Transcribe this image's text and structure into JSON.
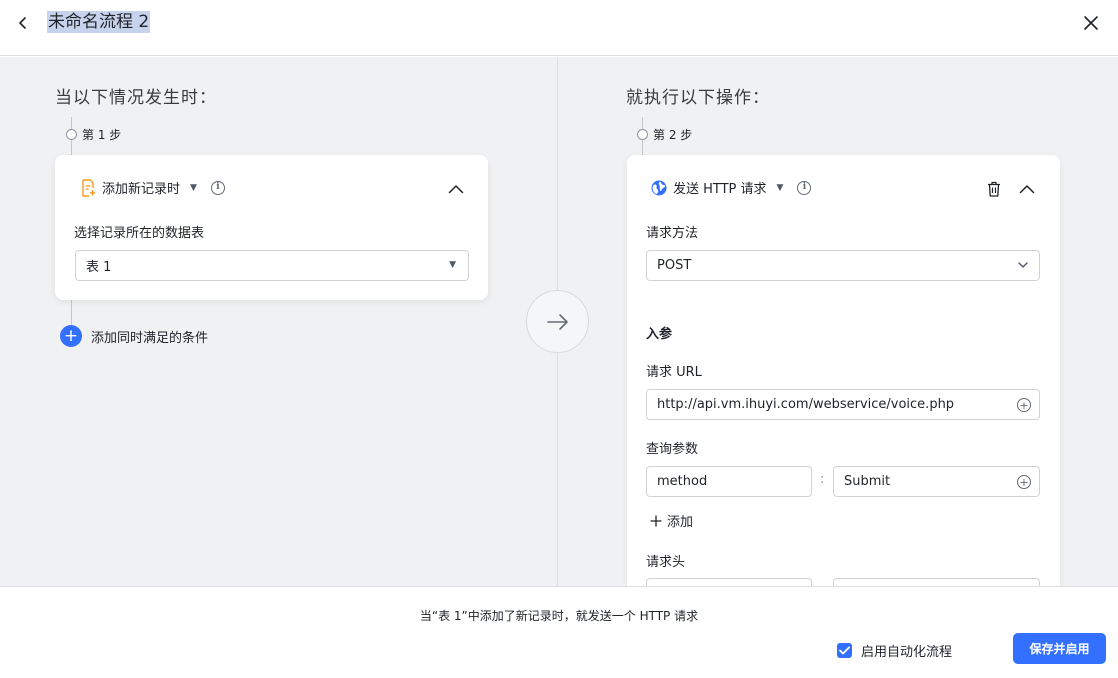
{
  "header": {
    "title": "未命名流程 2"
  },
  "trigger": {
    "heading": "当以下情况发生时：",
    "step_label": "第 1 步",
    "card_title": "添加新记录时",
    "table_label": "选择记录所在的数据表",
    "table_value": "表 1",
    "add_condition_label": "添加同时满足的条件"
  },
  "action": {
    "heading": "就执行以下操作：",
    "step_label": "第 2 步",
    "card_title": "发送 HTTP 请求",
    "method_label": "请求方法",
    "method_value": "POST",
    "params_heading": "入参",
    "url_label": "请求 URL",
    "url_value": "http://api.vm.ihuyi.com/webservice/voice.php",
    "query_label": "查询参数",
    "query_key": "method",
    "query_sep": ":",
    "query_value": "Submit",
    "add_label": "添加",
    "headers_label": "请求头"
  },
  "footer": {
    "summary": "当“表 1”中添加了新记录时，就发送一个 HTTP 请求",
    "enable_label": "启用自动化流程",
    "save_label": "保存并启用"
  },
  "colors": {
    "accent": "#3370ff",
    "trigger_icon": "#f59a23",
    "action_icon": "#3370ff"
  },
  "icons": {
    "back": "chevron-left-icon",
    "close": "close-icon",
    "trigger": "record-add-icon",
    "action": "globe-icon",
    "info": "info-icon",
    "collapse": "chevron-up-icon",
    "delete": "trash-icon",
    "add_field": "plus-circle-icon",
    "arrow": "arrow-right-icon"
  }
}
